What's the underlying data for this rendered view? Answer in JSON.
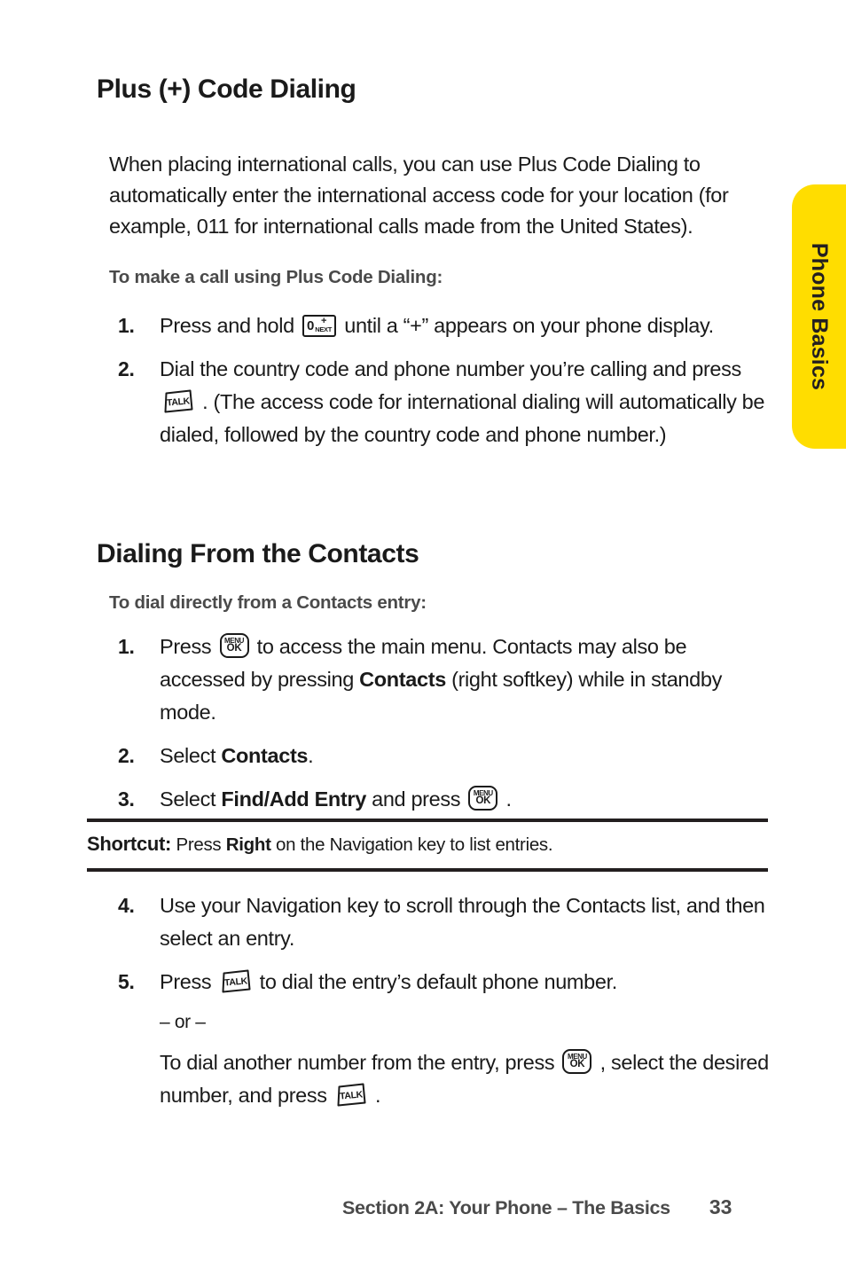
{
  "side_tab": {
    "label": "Phone Basics",
    "color": "#ffdd00"
  },
  "sections": [
    {
      "title": "Plus (+) Code Dialing",
      "intro": "When placing international calls, you can use Plus Code Dialing to automatically enter the international access code for your location (for example, 011 for international calls made from the United States).",
      "subhead": "To make a call using Plus Code Dialing:",
      "steps": [
        {
          "num": "1.",
          "pre": "Press and hold ",
          "key": "zero-next-key",
          "post": " until a “+” appears on your phone display."
        },
        {
          "num": "2.",
          "pre": "Dial the country code and phone number you’re calling and press ",
          "key": "talk-key",
          "post": " . (The access code for international dialing will automatically be dialed, followed by the country code and phone number.)"
        }
      ]
    },
    {
      "title": "Dialing From the Contacts",
      "subhead": "To dial directly from a Contacts entry:",
      "steps": [
        {
          "num": "1.",
          "pre": "Press ",
          "key": "menu-ok-key",
          "post_a": " to access the main menu. Contacts may also be accessed by pressing ",
          "bold": "Contacts",
          "post_b": " (right softkey) while in standby mode."
        },
        {
          "num": "2.",
          "pre": "Select ",
          "bold": "Contacts",
          "post": "."
        },
        {
          "num": "3.",
          "pre": "Select ",
          "bold": "Find/Add Entry",
          "post_a": " and press ",
          "key": "menu-ok-key",
          "post_b": " ."
        }
      ],
      "steps_after": [
        {
          "num": "4.",
          "text": "Use your Navigation key to scroll through the Contacts list, and then select an entry."
        },
        {
          "num": "5.",
          "pre": "Press ",
          "key": "talk-key",
          "post": " to dial the entry’s default phone number."
        }
      ],
      "or_label": "– or –",
      "alt": {
        "pre": "To dial another number from the entry, press ",
        "key1": "menu-ok-key",
        "mid": " , select the desired number, and press ",
        "key2": "talk-key",
        "post": " ."
      }
    }
  ],
  "shortcut": {
    "lead": "Shortcut:",
    "pre": " Press ",
    "bold": "Right",
    "post": " on the Navigation key to list entries."
  },
  "keys": {
    "menu_ok": {
      "top": "MENU",
      "bottom": "OK"
    },
    "talk": {
      "label": "TALK"
    },
    "zero_next": {
      "digit": "0",
      "plus": "+",
      "next": "NEXT"
    }
  },
  "footer": {
    "title": "Section 2A: Your Phone – The Basics",
    "page": "33"
  }
}
